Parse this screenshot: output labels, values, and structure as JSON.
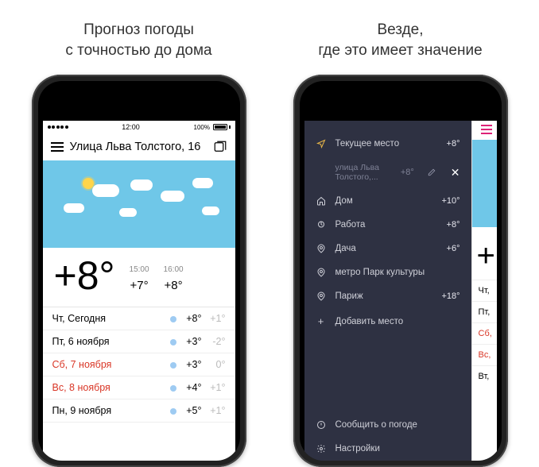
{
  "left": {
    "caption_l1": "Прогноз погоды",
    "caption_l2": "с точностью до дома",
    "status": {
      "time": "12:00",
      "battery": "100%"
    },
    "location": "Улица Льва Толстого, 16",
    "temp": "+8°",
    "hourly": [
      {
        "time": "15:00",
        "temp": "+7°"
      },
      {
        "time": "16:00",
        "temp": "+8°"
      }
    ],
    "days": [
      {
        "label": "Чт, Сегодня",
        "hi": "+8°",
        "lo": "+1°",
        "weekend": false
      },
      {
        "label": "Пт, 6 ноября",
        "hi": "+3°",
        "lo": "-2°",
        "weekend": false
      },
      {
        "label": "Сб, 7 ноября",
        "hi": "+3°",
        "lo": "0°",
        "weekend": true
      },
      {
        "label": "Вс, 8 ноября",
        "hi": "+4°",
        "lo": "+1°",
        "weekend": true
      },
      {
        "label": "Пн, 9 ноября",
        "hi": "+5°",
        "lo": "+1°",
        "weekend": false
      }
    ]
  },
  "right": {
    "caption_l1": "Везде,",
    "caption_l2": "где это имеет значение",
    "current": {
      "label": "Текущее место",
      "temp": "+8°"
    },
    "editing": {
      "label": "улица Льва Толстого,...",
      "temp": "+8°"
    },
    "places": [
      {
        "icon": "home",
        "label": "Дом",
        "temp": "+10°"
      },
      {
        "icon": "work",
        "label": "Работа",
        "temp": "+8°"
      },
      {
        "icon": "pin",
        "label": "Дача",
        "temp": "+6°"
      },
      {
        "icon": "pin",
        "label": "метро Парк культуры",
        "temp": ""
      },
      {
        "icon": "pin",
        "label": "Париж",
        "temp": "+18°"
      }
    ],
    "add": "Добавить место",
    "feedback": "Сообщить о погоде",
    "settings": "Настройки",
    "preview_days": [
      {
        "label": "Чт,",
        "weekend": false
      },
      {
        "label": "Пт,",
        "weekend": false
      },
      {
        "label": "Сб,",
        "weekend": true
      },
      {
        "label": "Вс,",
        "weekend": true
      },
      {
        "label": "Вт,",
        "weekend": false
      }
    ]
  }
}
